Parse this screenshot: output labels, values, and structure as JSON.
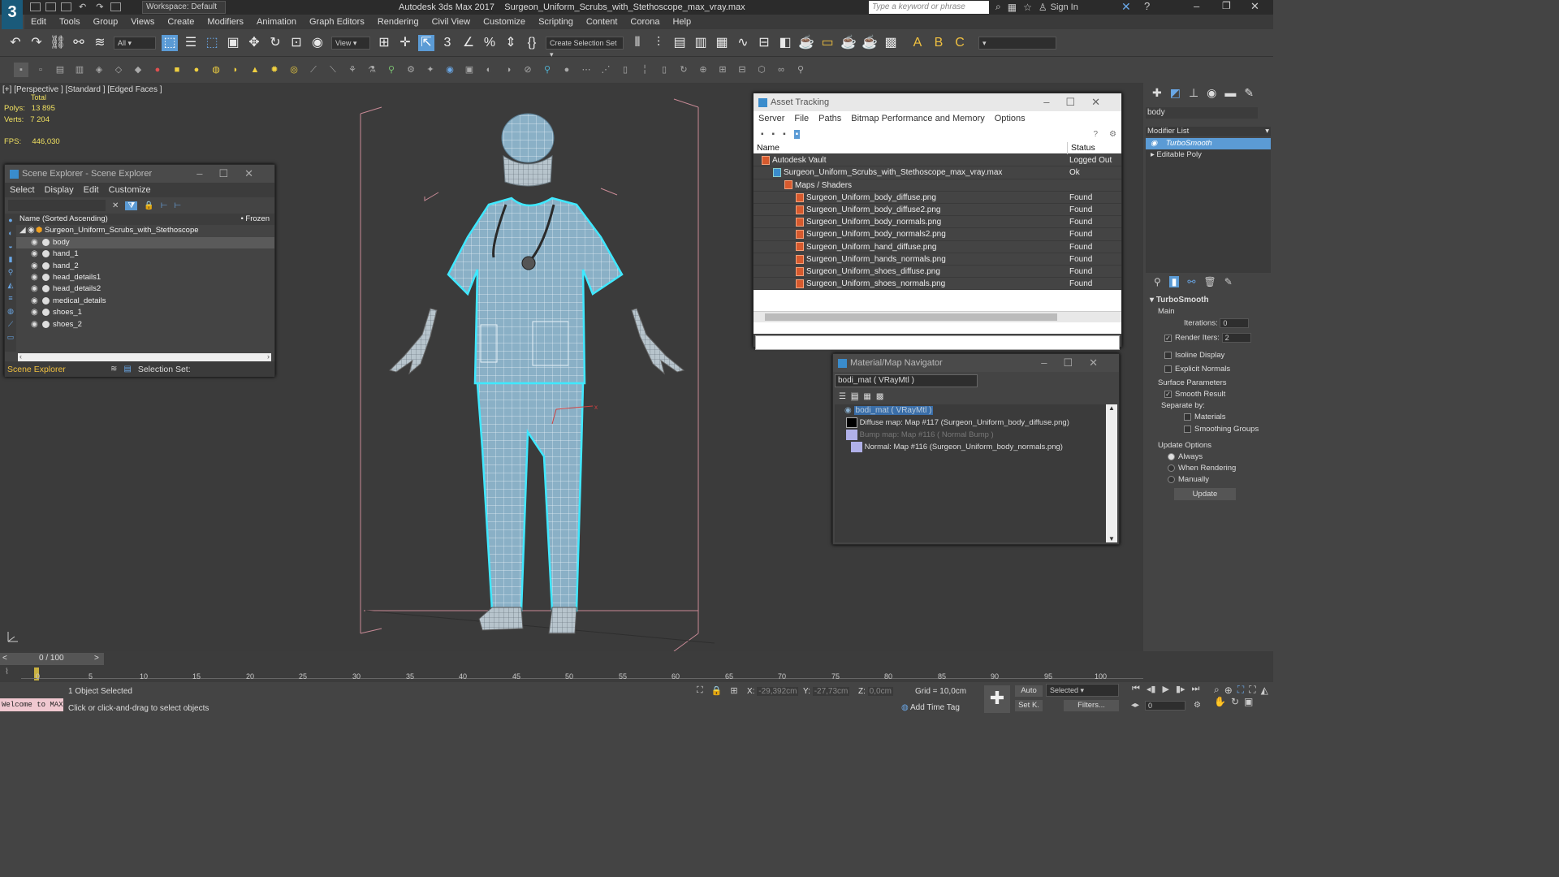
{
  "app": {
    "title": "Autodesk 3ds Max 2017",
    "file_title": "Surgeon_Uniform_Scrubs_with_Stethoscope_max_vray.max",
    "workspace": "Workspace: Default",
    "search_placeholder": "Type a keyword or phrase",
    "sign_in": "Sign In",
    "logo": "3"
  },
  "menu": [
    "Edit",
    "Tools",
    "Group",
    "Views",
    "Create",
    "Modifiers",
    "Animation",
    "Graph Editors",
    "Rendering",
    "Civil View",
    "Customize",
    "Scripting",
    "Content",
    "Corona",
    "Help"
  ],
  "toolbar": {
    "filter": "All",
    "ref_coord": "View",
    "selection_set": "Create Selection Set"
  },
  "viewport": {
    "label_plus": "[+]",
    "label_view": "[Perspective ]",
    "label_shading": "[Standard ]",
    "label_edged": "[Edged Faces ]",
    "stats_total": "Total",
    "polys_label": "Polys:",
    "polys": "13 895",
    "verts_label": "Verts:",
    "verts": "7 204",
    "fps_label": "FPS:",
    "fps": "446,030"
  },
  "scene_explorer": {
    "title": "Scene Explorer - Scene Explorer",
    "menu": [
      "Select",
      "Display",
      "Edit",
      "Customize"
    ],
    "col_name": "Name (Sorted Ascending)",
    "col_frozen": "• Frozen",
    "root": "Surgeon_Uniform_Scrubs_with_Stethoscope",
    "items": [
      "body",
      "hand_1",
      "hand_2",
      "head_details1",
      "head_details2",
      "medical_details",
      "shoes_1",
      "shoes_2"
    ],
    "footer_label": "Scene Explorer",
    "selection_set": "Selection Set:"
  },
  "asset_tracking": {
    "title": "Asset Tracking",
    "menu": [
      "Server",
      "File",
      "Paths",
      "Bitmap Performance and Memory",
      "Options"
    ],
    "col_name": "Name",
    "col_status": "Status",
    "rows": [
      {
        "name": "Autodesk Vault",
        "status": "Logged Out (..."
      },
      {
        "name": "Surgeon_Uniform_Scrubs_with_Stethoscope_max_vray.max",
        "status": "Ok"
      },
      {
        "name": "Maps / Shaders",
        "status": ""
      },
      {
        "name": "Surgeon_Uniform_body_diffuse.png",
        "status": "Found"
      },
      {
        "name": "Surgeon_Uniform_body_diffuse2.png",
        "status": "Found"
      },
      {
        "name": "Surgeon_Uniform_body_normals.png",
        "status": "Found"
      },
      {
        "name": "Surgeon_Uniform_body_normals2.png",
        "status": "Found"
      },
      {
        "name": "Surgeon_Uniform_hand_diffuse.png",
        "status": "Found"
      },
      {
        "name": "Surgeon_Uniform_hands_normals.png",
        "status": "Found"
      },
      {
        "name": "Surgeon_Uniform_shoes_diffuse.png",
        "status": "Found"
      },
      {
        "name": "Surgeon_Uniform_shoes_normals.png",
        "status": "Found"
      }
    ]
  },
  "material_nav": {
    "title": "Material/Map Navigator",
    "current": "bodi_mat  ( VRayMtl )",
    "tree": [
      "bodi_mat  ( VRayMtl )",
      "Diffuse map: Map #117 (Surgeon_Uniform_body_diffuse.png)",
      "Bump map: Map #116  ( Normal Bump )",
      "Normal: Map #116 (Surgeon_Uniform_body_normals.png)"
    ]
  },
  "command_panel": {
    "object_name": "body",
    "modifier_list": "Modifier List",
    "stack": [
      "TurboSmooth",
      "Editable Poly"
    ],
    "rollout_title": "TurboSmooth",
    "main": "Main",
    "iterations_label": "Iterations:",
    "iterations": "0",
    "render_iters_label": "Render Iters:",
    "render_iters": "2",
    "isoline": "Isoline Display",
    "explicit": "Explicit Normals",
    "surface_params": "Surface Parameters",
    "smooth_result": "Smooth Result",
    "separate_by": "Separate by:",
    "materials": "Materials",
    "smoothing_groups": "Smoothing Groups",
    "update_options": "Update Options",
    "always": "Always",
    "when_rendering": "When Rendering",
    "manually": "Manually",
    "update": "Update"
  },
  "timeline": {
    "frame": "0 / 100",
    "ticks": [
      "0",
      "5",
      "10",
      "15",
      "20",
      "25",
      "30",
      "35",
      "40",
      "45",
      "50",
      "55",
      "60",
      "65",
      "70",
      "75",
      "80",
      "85",
      "90",
      "95",
      "100"
    ]
  },
  "status": {
    "maxscript": "Welcome to MAX",
    "selected": "1 Object Selected",
    "prompt": "Click or click-and-drag to select objects",
    "x_label": "X:",
    "x": "-29,392cm",
    "y_label": "Y:",
    "y": "-27,73cm",
    "z_label": "Z:",
    "z": "0,0cm",
    "grid": "Grid = 10,0cm",
    "add_time_tag": "Add Time Tag",
    "auto": "Auto",
    "set_key": "Set K.",
    "selected_dd": "Selected",
    "filters": "Filters...",
    "frame_field": "0"
  },
  "colors": {
    "accent": "#5b9bd5",
    "selection": "#00d8ff",
    "mesh": "#8fb4cc",
    "found": "#eeeeee"
  }
}
